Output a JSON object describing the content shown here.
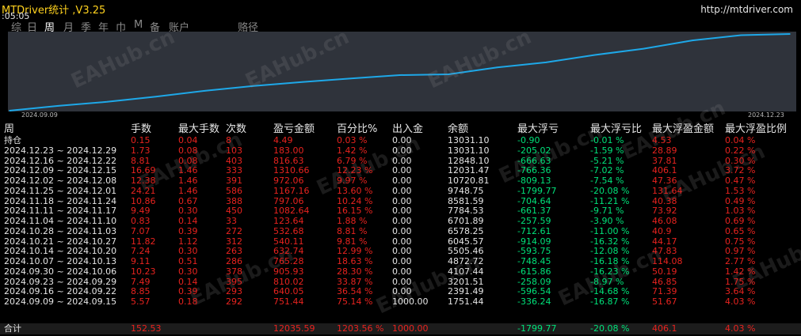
{
  "app": {
    "title": "MTDriver统计 ,V3.25",
    "time": ":05:05",
    "url": "http://mtdriver.com"
  },
  "nav": {
    "tabs": [
      "综",
      "日",
      "周",
      "月",
      "季",
      "年",
      "巾",
      "M",
      "备",
      "账户",
      "赂径"
    ],
    "active": "周"
  },
  "watermark": "EAHub.cn",
  "chart_data": {
    "type": "line",
    "x": [
      "2024.09.09",
      "2024.09.16",
      "2024.09.23",
      "2024.09.30",
      "2024.10.07",
      "2024.10.14",
      "2024.10.21",
      "2024.10.28",
      "2024.11.04",
      "2024.11.11",
      "2024.11.18",
      "2024.11.25",
      "2024.12.02",
      "2024.12.09",
      "2024.12.16",
      "2024.12.23"
    ],
    "values": [
      1751.44,
      2391.49,
      3201.51,
      4107.44,
      4872.72,
      5505.46,
      6045.57,
      6578.25,
      6701.89,
      7784.53,
      8581.59,
      9748.75,
      10720.81,
      12031.47,
      12848.1,
      13031.1
    ],
    "start_value": 1000.0,
    "xtick_labels": [
      "2024.09.09",
      "2024.12.23"
    ],
    "line_color": "#1ea8e8",
    "grid": false
  },
  "table": {
    "headers": [
      "周",
      "手数",
      "最大手数",
      "次数",
      "盈亏金额",
      "百分比%",
      "出入金",
      "余额",
      "最大浮亏",
      "最大浮亏比",
      "最大浮盈金额",
      "最大浮盈比例"
    ],
    "rows": [
      [
        "持仓",
        "0.15",
        "0.04",
        "8",
        "4.49",
        "0.03 %",
        "0.00",
        "13031.10",
        "-0.90",
        "-0.01 %",
        "4.53",
        "0.04 %"
      ],
      [
        "2024.12.23 ~ 2024.12.29",
        "1.73",
        "0.08",
        "103",
        "183.00",
        "1.42 %",
        "0.00",
        "13031.10",
        "-205.02",
        "-1.59 %",
        "28.89",
        "0.22 %"
      ],
      [
        "2024.12.16 ~ 2024.12.22",
        "8.81",
        "0.08",
        "403",
        "816.63",
        "6.79 %",
        "0.00",
        "12848.10",
        "-666.63",
        "-5.21 %",
        "37.81",
        "0.30 %"
      ],
      [
        "2024.12.09 ~ 2024.12.15",
        "16.69",
        "1.46",
        "333",
        "1310.66",
        "12.23 %",
        "0.00",
        "12031.47",
        "-766.36",
        "-7.02 %",
        "406.1",
        "3.72 %"
      ],
      [
        "2024.12.02 ~ 2024.12.08",
        "12.38",
        "1.46",
        "391",
        "972.06",
        "9.97 %",
        "0.00",
        "10720.81",
        "-809.13",
        "-7.54 %",
        "47.36",
        "0.47 %"
      ],
      [
        "2024.11.25 ~ 2024.12.01",
        "24.21",
        "1.46",
        "586",
        "1167.16",
        "13.60 %",
        "0.00",
        "9748.75",
        "-1799.77",
        "-20.08 %",
        "131.64",
        "1.53 %"
      ],
      [
        "2024.11.18 ~ 2024.11.24",
        "10.86",
        "0.67",
        "388",
        "797.06",
        "10.24 %",
        "0.00",
        "8581.59",
        "-704.64",
        "-11.21 %",
        "40.38",
        "0.49 %"
      ],
      [
        "2024.11.11 ~ 2024.11.17",
        "9.49",
        "0.30",
        "450",
        "1082.64",
        "16.15 %",
        "0.00",
        "7784.53",
        "-661.37",
        "-9.71 %",
        "73.92",
        "1.03 %"
      ],
      [
        "2024.11.04 ~ 2024.11.10",
        "0.83",
        "0.14",
        "33",
        "123.64",
        "1.88 %",
        "0.00",
        "6701.89",
        "-257.59",
        "-3.90 %",
        "46.08",
        "0.69 %"
      ],
      [
        "2024.10.28 ~ 2024.11.03",
        "7.07",
        "0.39",
        "272",
        "532.68",
        "8.81 %",
        "0.00",
        "6578.25",
        "-712.61",
        "-11.00 %",
        "40.9",
        "0.65 %"
      ],
      [
        "2024.10.21 ~ 2024.10.27",
        "11.82",
        "1.12",
        "312",
        "540.11",
        "9.81 %",
        "0.00",
        "6045.57",
        "-914.09",
        "-16.32 %",
        "44.17",
        "0.75 %"
      ],
      [
        "2024.10.14 ~ 2024.10.20",
        "7.24",
        "0.30",
        "263",
        "632.74",
        "12.99 %",
        "0.00",
        "5505.46",
        "-593.75",
        "-12.08 %",
        "47.83",
        "0.97 %"
      ],
      [
        "2024.10.07 ~ 2024.10.13",
        "9.11",
        "0.51",
        "286",
        "765.28",
        "18.63 %",
        "0.00",
        "4872.72",
        "-748.45",
        "-16.18 %",
        "114.08",
        "2.77 %"
      ],
      [
        "2024.09.30 ~ 2024.10.06",
        "10.23",
        "0.30",
        "378",
        "905.93",
        "28.30 %",
        "0.00",
        "4107.44",
        "-615.86",
        "-16.23 %",
        "50.19",
        "1.42 %"
      ],
      [
        "2024.09.23 ~ 2024.09.29",
        "7.49",
        "0.14",
        "395",
        "810.02",
        "33.87 %",
        "0.00",
        "3201.51",
        "-258.09",
        "-8.97 %",
        "46.85",
        "1.75 %"
      ],
      [
        "2024.09.16 ~ 2024.09.22",
        "8.85",
        "0.39",
        "293",
        "640.05",
        "36.54 %",
        "0.00",
        "2391.49",
        "-596.54",
        "-14.68 %",
        "71.39",
        "3.64 %"
      ],
      [
        "2024.09.09 ~ 2024.09.15",
        "5.57",
        "0.18",
        "292",
        "751.44",
        "75.14 %",
        "1000.00",
        "1751.44",
        "-336.24",
        "-16.87 %",
        "51.67",
        "4.03 %"
      ]
    ],
    "total": [
      "合计",
      "152.53",
      "",
      "",
      "12035.59",
      "1203.56 %",
      "1000.00",
      "",
      "-1799.77",
      "-20.08 %",
      "406.1",
      "4.03 %"
    ]
  },
  "colors": {
    "positive": "#e8231f",
    "negative": "#00e27a",
    "neutral": "#e6e6e6",
    "title": "#ffd21e",
    "chart_bg": "#2f333b",
    "line": "#1ea8e8"
  }
}
